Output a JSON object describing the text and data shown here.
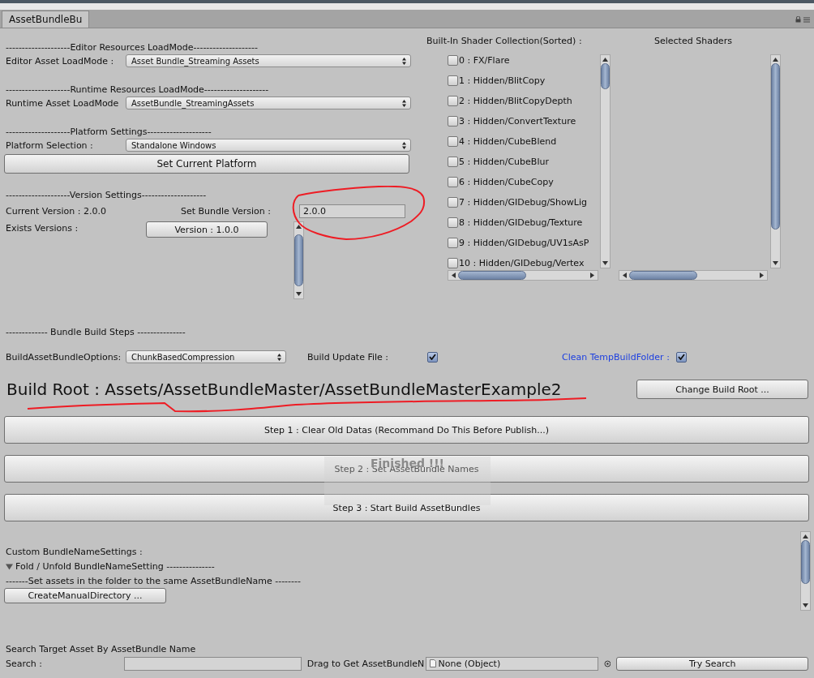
{
  "window": {
    "tab": "AssetBundleBu"
  },
  "load_modes": [
    {
      "header": "--------------------Editor Resources LoadMode--------------------",
      "label": "Editor Asset LoadMode :",
      "value": "Asset Bundle_Streaming Assets"
    },
    {
      "header": "--------------------Runtime Resources LoadMode--------------------",
      "label": "Runtime Asset LoadMode",
      "value": "AssetBundle_StreamingAssets"
    },
    {
      "header": "--------------------Platform Settings--------------------",
      "label": "Platform Selection :",
      "value": "Standalone Windows"
    }
  ],
  "set_platform_button": "Set Current Platform",
  "version": {
    "header": "--------------------Version Settings--------------------",
    "current": "Current Version : 2.0.0",
    "set_label": "Set Bundle Version :",
    "set_value": "2.0.0",
    "exists_label": "Exists Versions :",
    "versions": [
      "Version : 1.0.0"
    ]
  },
  "shaders": {
    "title": "Built-In Shader Collection(Sorted) :",
    "selected_title": "Selected Shaders",
    "items": [
      {
        "label": "0 : FX/Flare",
        "checked": false
      },
      {
        "label": "1 : Hidden/BlitCopy",
        "checked": false
      },
      {
        "label": "2 : Hidden/BlitCopyDepth",
        "checked": false
      },
      {
        "label": "3 : Hidden/ConvertTexture",
        "checked": false
      },
      {
        "label": "4 : Hidden/CubeBlend",
        "checked": false
      },
      {
        "label": "5 : Hidden/CubeBlur",
        "checked": false
      },
      {
        "label": "6 : Hidden/CubeCopy",
        "checked": false
      },
      {
        "label": "7 : Hidden/GIDebug/ShowLig",
        "checked": false
      },
      {
        "label": "8 : Hidden/GIDebug/Texture",
        "checked": false
      },
      {
        "label": "9 : Hidden/GIDebug/UV1sAsP",
        "checked": false
      },
      {
        "label": "10 : Hidden/GIDebug/Vertex",
        "checked": false
      }
    ]
  },
  "build_steps": {
    "header": "------------- Bundle Build Steps ---------------",
    "options_label": "BuildAssetBundleOptions:",
    "options_value": "ChunkBasedCompression",
    "update_label": "Build Update File :",
    "update_checked": true,
    "clean_label": "Clean TempBuildFolder :",
    "clean_checked": true
  },
  "build_root": {
    "text": "Build Root : Assets/AssetBundleMaster/AssetBundleMasterExample2",
    "button": "Change Build Root ..."
  },
  "steps": [
    "Step 1 : Clear Old Datas (Recommand Do This Before Publish...)",
    "Step 2 : Set AssetBundle Names",
    "Step 3 : Start Build AssetBundles"
  ],
  "notification": "Finished !!!",
  "custom": {
    "title": "Custom BundleNameSettings :",
    "foldout": {
      "label": "Fold / Unfold BundleNameSetting ---------------",
      "expanded": true
    },
    "note": "-------Set assets in the folder to the same AssetBundleName --------",
    "button": "CreateManualDirectory ..."
  },
  "search": {
    "title": "Search Target Asset By AssetBundle Name",
    "label": "Search :",
    "drag_label": "Drag to Get AssetBundleN",
    "object_value": "None (Object)",
    "button": "Try Search"
  }
}
